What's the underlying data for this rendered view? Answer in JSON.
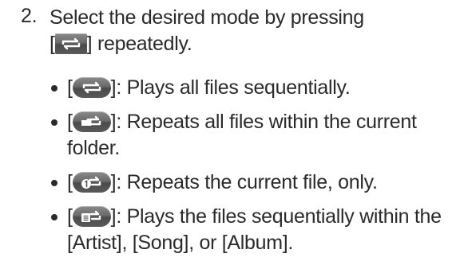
{
  "step": {
    "number": "2.",
    "line1": "Select the desired mode by pressing",
    "bracket_open": "[",
    "bracket_close": "]",
    "line2_suffix": " repeatedly."
  },
  "items": [
    {
      "icon": "repeat-all-icon",
      "bracket_open": "[",
      "bracket_close": "]",
      "text": ": Plays all files sequentially."
    },
    {
      "icon": "repeat-folder-icon",
      "bracket_open": "[",
      "bracket_close": "]",
      "text": ": Repeats all files within the current folder."
    },
    {
      "icon": "repeat-one-icon",
      "bracket_open": "[",
      "bracket_close": "]",
      "text": ": Repeats the current file, only."
    },
    {
      "icon": "repeat-category-icon",
      "bracket_open": "[",
      "bracket_close": "]",
      "text": ": Plays the files sequentially within the [Artist], [Song], or [Album]."
    }
  ],
  "colors": {
    "text": "#2a2a2a",
    "button_top": "#8a8a8a",
    "button_bottom": "#4a4a4a"
  }
}
